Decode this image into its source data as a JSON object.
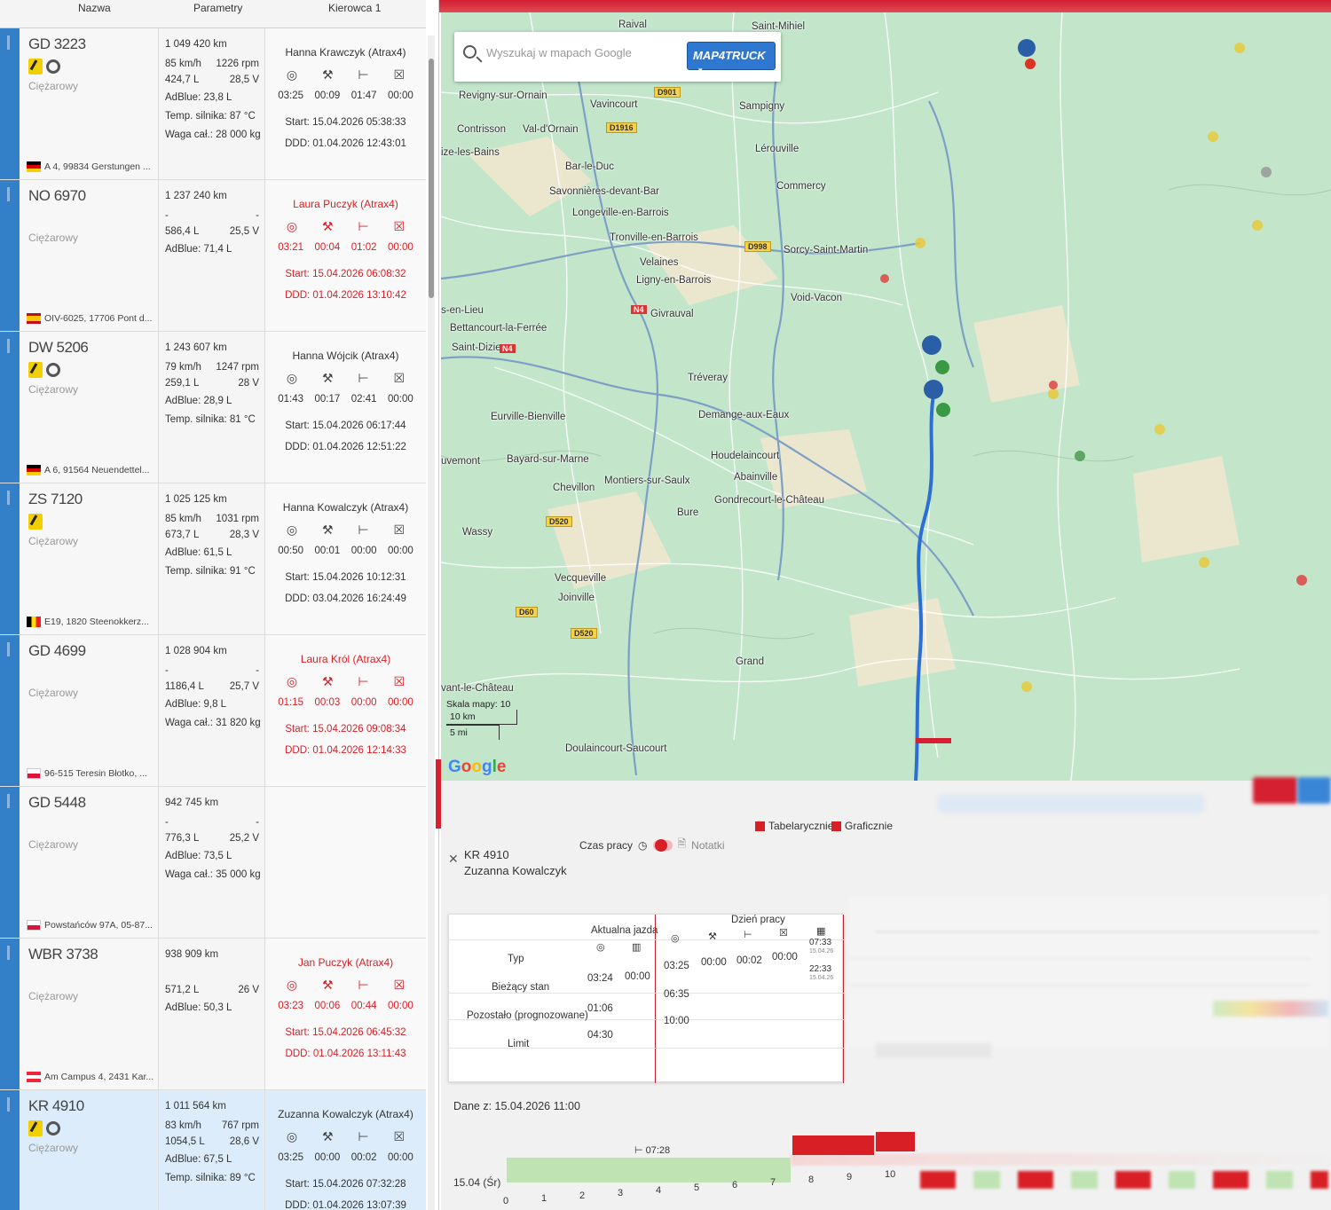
{
  "columns": {
    "name": "Nazwa",
    "params": "Parametry",
    "driver": "Kierowca 1"
  },
  "vehicles": [
    {
      "plate": "GD 3223",
      "type": "Ciężarowy",
      "icons": [
        "key-icon",
        "tyre-icon"
      ],
      "location": "A 4, 99834 Gerstungen ...",
      "flag": "de",
      "odometer": "1 049 420 km",
      "speed": "85 km/h",
      "rpm": "1226 rpm",
      "fuel": "424,7 L",
      "voltage": "28,5 V",
      "extra": [
        "AdBlue: 23,8 L",
        "Temp. silnika: 87 °C",
        "Waga cał.: 28 000 kg"
      ],
      "driver": "Hanna Krawczyk (Atrax4)",
      "alert": false,
      "t1": "03:25",
      "t2": "00:09",
      "t3": "01:47",
      "t4": "00:00",
      "start": "Start: 15.04.2026 05:38:33",
      "ddd": "DDD: 01.04.2026 12:43:01"
    },
    {
      "plate": "NO 6970",
      "type": "Ciężarowy",
      "icons": [],
      "location": "OIV-6025, 17706 Pont d...",
      "flag": "es",
      "odometer": "1 237 240 km",
      "speed": "-",
      "rpm": "-",
      "fuel": "586,4 L",
      "voltage": "25,5 V",
      "extra": [
        "AdBlue: 71,4 L"
      ],
      "driver": "Laura Puczyk (Atrax4)",
      "alert": true,
      "t1": "03:21",
      "t2": "00:04",
      "t3": "01:02",
      "t4": "00:00",
      "start": "Start: 15.04.2026 06:08:32",
      "ddd": "DDD: 01.04.2026 13:10:42"
    },
    {
      "plate": "DW 5206",
      "type": "Ciężarowy",
      "icons": [
        "key-icon",
        "tyre-icon"
      ],
      "location": "A 6, 91564 Neuendettel...",
      "flag": "de",
      "odometer": "1 243 607 km",
      "speed": "79 km/h",
      "rpm": "1247 rpm",
      "fuel": "259,1 L",
      "voltage": "28 V",
      "extra": [
        "AdBlue: 28,9 L",
        "Temp. silnika: 81 °C"
      ],
      "driver": "Hanna Wójcik (Atrax4)",
      "alert": false,
      "t1": "01:43",
      "t2": "00:17",
      "t3": "02:41",
      "t4": "00:00",
      "start": "Start: 15.04.2026 06:17:44",
      "ddd": "DDD: 01.04.2026 12:51:22"
    },
    {
      "plate": "ZS 7120",
      "type": "Ciężarowy",
      "icons": [
        "key-icon"
      ],
      "location": "E19, 1820 Steenokkerz...",
      "flag": "be",
      "odometer": "1 025 125 km",
      "speed": "85 km/h",
      "rpm": "1031 rpm",
      "fuel": "673,7 L",
      "voltage": "28,3 V",
      "extra": [
        "AdBlue: 61,5 L",
        "Temp. silnika: 91 °C"
      ],
      "driver": "Hanna Kowalczyk (Atrax4)",
      "alert": false,
      "t1": "00:50",
      "t2": "00:01",
      "t3": "00:00",
      "t4": "00:00",
      "start": "Start: 15.04.2026 10:12:31",
      "ddd": "DDD: 03.04.2026 16:24:49"
    },
    {
      "plate": "GD 4699",
      "type": "Ciężarowy",
      "icons": [],
      "location": "96-515 Teresin Błotko, ...",
      "flag": "pl",
      "odometer": "1 028 904 km",
      "speed": "-",
      "rpm": "-",
      "fuel": "1186,4 L",
      "voltage": "25,7 V",
      "extra": [
        "AdBlue: 9,8 L",
        "Waga cał.: 31 820 kg"
      ],
      "driver": "Laura Król (Atrax4)",
      "alert": true,
      "t1": "01:15",
      "t2": "00:03",
      "t3": "00:00",
      "t4": "00:00",
      "start": "Start: 15.04.2026 09:08:34",
      "ddd": "DDD: 01.04.2026 12:14:33"
    },
    {
      "plate": "GD 5448",
      "type": "Ciężarowy",
      "icons": [],
      "location": "Powstańców 97A, 05-87...",
      "flag": "pl",
      "odometer": "942 745 km",
      "speed": "-",
      "rpm": "-",
      "fuel": "776,3 L",
      "voltage": "25,2 V",
      "extra": [
        "AdBlue: 73,5 L",
        "Waga cał.: 35 000 kg"
      ],
      "driver": "",
      "alert": false,
      "t1": "",
      "t2": "",
      "t3": "",
      "t4": "",
      "start": "",
      "ddd": "",
      "noDriver": true
    },
    {
      "plate": "WBR 3738",
      "type": "Ciężarowy",
      "icons": [],
      "location": "Am Campus 4, 2431 Kar...",
      "flag": "at",
      "odometer": "938 909 km",
      "speed": "",
      "rpm": "",
      "fuel": "571,2 L",
      "voltage": "26 V",
      "extra": [
        "AdBlue: 50,3 L"
      ],
      "driver": "Jan Puczyk (Atrax4)",
      "alert": true,
      "t1": "03:23",
      "t2": "00:06",
      "t3": "00:44",
      "t4": "00:00",
      "start": "Start: 15.04.2026 06:45:32",
      "ddd": "DDD: 01.04.2026 13:11:43"
    },
    {
      "plate": "KR 4910",
      "type": "Ciężarowy",
      "icons": [
        "key-icon",
        "tyre-icon"
      ],
      "location": "",
      "flag": "",
      "odometer": "1 011 564 km",
      "speed": "83 km/h",
      "rpm": "767 rpm",
      "fuel": "1054,5 L",
      "voltage": "28,6 V",
      "extra": [
        "AdBlue: 67,5 L",
        "Temp. silnika: 89 °C"
      ],
      "driver": "Zuzanna Kowalczyk (Atrax4)",
      "alert": false,
      "t1": "03:25",
      "t2": "00:00",
      "t3": "00:02",
      "t4": "00:00",
      "start": "Start: 15.04.2026 07:32:28",
      "ddd": "DDD: 01.04.2026 13:07:39",
      "selected": true
    }
  ],
  "map": {
    "search_placeholder": "Wyszukaj w mapach Google",
    "provider_button": "MAP4TRUCK",
    "scale_label": "Skala mapy: 10",
    "scale_km": "10 km",
    "scale_mi": "5 mi",
    "google": "Google",
    "labels": [
      "Raival",
      "Saint-Mihiel",
      "Revigny-sur-Ornain",
      "Vavincourt",
      "Sampigny",
      "Contrisson",
      "Val-d'Ornain",
      "Bar-le-Duc",
      "Lérouville",
      "Savonnières-devant-Bar",
      "Commercy",
      "Longeville-en-Barrois",
      "Tronville-en-Barrois",
      "Sorcy-Saint-Martin",
      "Velaines",
      "Ligny-en-Barrois",
      "Void-Vacon",
      "s-en-Lieu",
      "Givrauval",
      "Bettancourt-la-Ferrée",
      "Saint-Dizier",
      "Tréveray",
      "Eurville-Bienville",
      "Demange-aux-Eaux",
      "Houdelaincourt",
      "Bayard-sur-Marne",
      "Abainville",
      "uvemont",
      "Chevillon",
      "Montiers-sur-Saulx",
      "Gondrecourt-le-Château",
      "Bure",
      "Wassy",
      "Vecqueville",
      "Joinville",
      "Grand",
      "vant-le-Château",
      "Doulaincourt-Saucourt",
      "ize-les-Bains"
    ],
    "road_shields": [
      "D901",
      "D1916",
      "D998",
      "N4",
      "N4",
      "D520",
      "D60",
      "D520"
    ]
  },
  "detail": {
    "plate": "KR 4910",
    "driver": "Zuzanna Kowalczyk",
    "worktime_label": "Czas pracy",
    "notes_label": "Notatki",
    "tab_table": "Tabelarycznie",
    "tab_graph": "Graficznie",
    "current_drive": "Aktualna jazda",
    "work_day": "Dzień pracy",
    "rows": [
      "Typ",
      "Bieżący stan",
      "Pozostało (prognozowane)",
      "Limit"
    ],
    "current_values": {
      "a1": "03:24",
      "a2": "00:00",
      "r1": "01:06",
      "l1": "04:30"
    },
    "day_values": {
      "d1": "03:25",
      "d2": "00:00",
      "d3": "00:02",
      "d4": "00:00",
      "d5": "07:33",
      "d5sub": "15.04.26",
      "d6": "22:33",
      "d6sub": "15.04.26",
      "r1": "06:35",
      "l1": "10:00"
    },
    "data_from": "Dane z: 15.04.2026 11:00",
    "day_label": "15.04 (Śr)",
    "rest_tag": "07:28",
    "ticks": [
      "0",
      "1",
      "2",
      "3",
      "4",
      "5",
      "6",
      "7",
      "8",
      "9",
      "10"
    ]
  }
}
